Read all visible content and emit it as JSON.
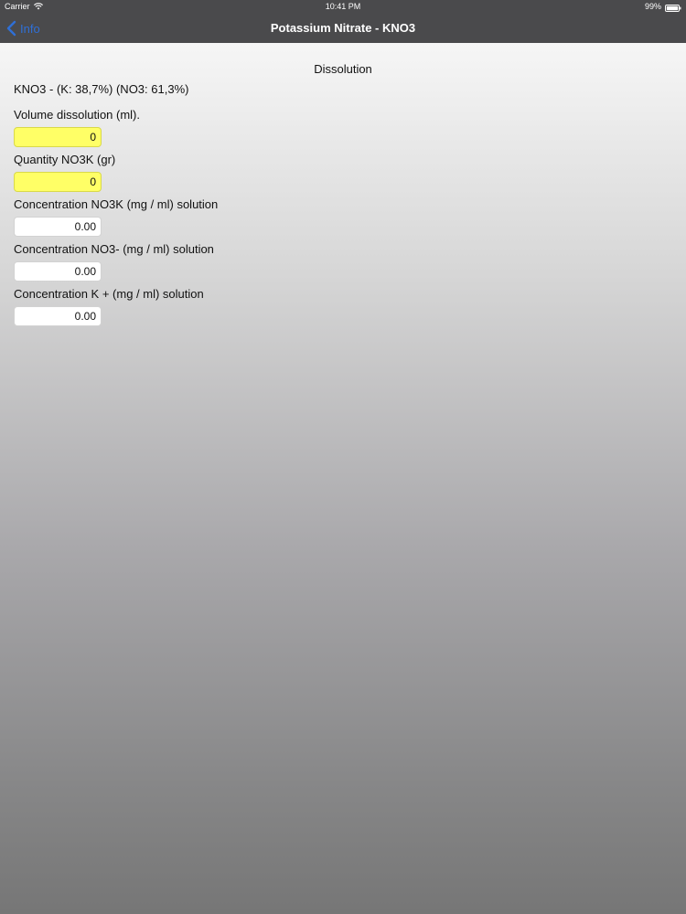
{
  "status_bar": {
    "carrier": "Carrier",
    "time": "10:41 PM",
    "battery": "99%"
  },
  "nav": {
    "back_label": "Info",
    "title": "Potassium Nitrate - KNO3"
  },
  "main": {
    "section_title": "Dissolution",
    "formula": "KNO3 - (K: 38,7%) (NO3: 61,3%)",
    "fields": [
      {
        "label": "Volume dissolution (ml).",
        "value": "0",
        "editable": true
      },
      {
        "label": "Quantity NO3K (gr)",
        "value": "0",
        "editable": true
      },
      {
        "label": "Concentration NO3K (mg / ml) solution",
        "value": "0.00",
        "editable": false
      },
      {
        "label": "Concentration NO3- (mg / ml) solution",
        "value": "0.00",
        "editable": false
      },
      {
        "label": "Concentration K + (mg / ml) solution",
        "value": "0.00",
        "editable": false
      }
    ]
  },
  "colors": {
    "nav_background": "#4a4a4c",
    "back_button": "#2f6fd6",
    "editable_field": "#ffff66",
    "readonly_field": "#ffffff"
  },
  "icons": {
    "wifi": "wifi-icon",
    "battery": "battery-icon",
    "back": "chevron-left-icon"
  }
}
